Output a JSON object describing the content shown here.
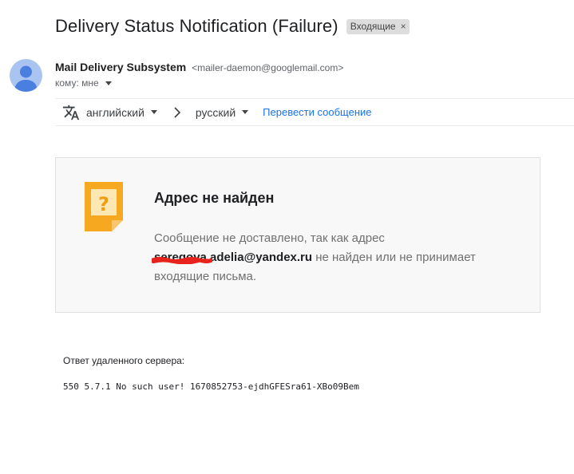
{
  "header": {
    "subject": "Delivery Status Notification (Failure)",
    "label_chip": "Входящие",
    "label_remove": "×"
  },
  "sender": {
    "name": "Mail Delivery Subsystem",
    "email": "<mailer-daemon@googlemail.com>",
    "to_label": "кому: мне"
  },
  "translate_bar": {
    "icon": "translate-icon",
    "from_language": "английский",
    "to_language": "русский",
    "translate_link": "Перевести сообщение"
  },
  "bounce_notice": {
    "icon": "missing-address-icon",
    "title": "Адрес не найден",
    "body_before": "Сообщение не доставлено, так как адрес ",
    "recipient_email": "seregova.adelia@yandex.ru",
    "body_after": " не найден или не принимает входящие письма."
  },
  "server_response": {
    "label": "Ответ удаленного сервера:",
    "code": "550 5.7.1 No such user! 1670852753-ejdhGFESra61-XBo09Bem"
  },
  "colors": {
    "link": "#1a73e8",
    "note_icon": "#f6a821",
    "redaction": "#e8221c",
    "avatar": "#a9c4f0"
  }
}
